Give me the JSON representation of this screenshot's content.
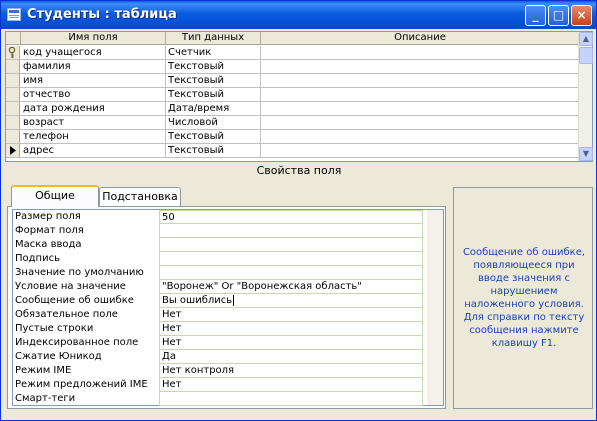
{
  "window": {
    "title": "Студенты : таблица",
    "buttons": {
      "minimize": "_",
      "maximize": "□",
      "close": "×"
    }
  },
  "grid": {
    "headers": [
      "Имя поля",
      "Тип данных",
      "Описание"
    ],
    "rows": [
      {
        "name": "код учащегося",
        "type": "Счетчик",
        "description": "",
        "marker": "key-icon"
      },
      {
        "name": "фамилия",
        "type": "Текстовый",
        "description": "",
        "marker": ""
      },
      {
        "name": "имя",
        "type": "Текстовый",
        "description": "",
        "marker": ""
      },
      {
        "name": "отчество",
        "type": "Текстовый",
        "description": "",
        "marker": ""
      },
      {
        "name": "дата рождения",
        "type": "Дата/время",
        "description": "",
        "marker": ""
      },
      {
        "name": "возраст",
        "type": "Числовой",
        "description": "",
        "marker": ""
      },
      {
        "name": "телефон",
        "type": "Текстовый",
        "description": "",
        "marker": ""
      },
      {
        "name": "адрес",
        "type": "Текстовый",
        "description": "",
        "marker": "row-pointer-icon"
      }
    ]
  },
  "properties": {
    "section_label": "Свойства поля",
    "tabs": [
      "Общие",
      "Подстановка"
    ],
    "active_tab": "Общие",
    "rows": [
      {
        "label": "Размер поля",
        "value": "50"
      },
      {
        "label": "Формат поля",
        "value": ""
      },
      {
        "label": "Маска ввода",
        "value": ""
      },
      {
        "label": "Подпись",
        "value": ""
      },
      {
        "label": "Значение по умолчанию",
        "value": ""
      },
      {
        "label": "Условие на значение",
        "value": "\"Воронеж\" Or \"Воронежская область\""
      },
      {
        "label": "Сообщение об ошибке",
        "value": "Вы ошиблись"
      },
      {
        "label": "Обязательное поле",
        "value": "Нет"
      },
      {
        "label": "Пустые строки",
        "value": "Нет"
      },
      {
        "label": "Индексированное поле",
        "value": "Нет"
      },
      {
        "label": "Сжатие Юникод",
        "value": "Да"
      },
      {
        "label": "Режим IME",
        "value": "Нет контроля"
      },
      {
        "label": "Режим предложений IME",
        "value": "Нет"
      },
      {
        "label": "Смарт-теги",
        "value": ""
      }
    ],
    "help_text": "Сообщение об ошибке, появляющееся при вводе значения с нарушением наложенного условия. Для справки по тексту сообщения нажмите клавишу F1."
  },
  "colors": {
    "titlebar": "#0a5fe4",
    "help_text": "#1a3fbf",
    "tab_highlight": "#f5b53a"
  }
}
